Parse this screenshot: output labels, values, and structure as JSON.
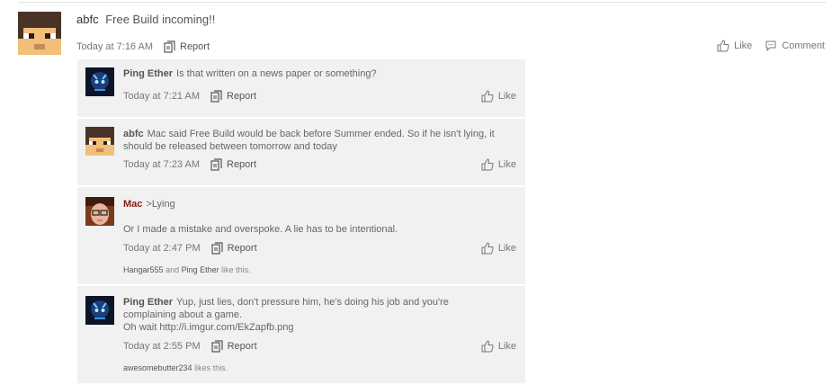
{
  "main_post": {
    "username": "abfc",
    "message": "Free Build incoming!!",
    "time": "Today at 7:16 AM",
    "report_label": "Report",
    "like_label": "Like",
    "comment_label": "Comment"
  },
  "comments": [
    {
      "username": "Ping Ether",
      "lines": [
        "Is that written on a news paper or something?"
      ],
      "time": "Today at 7:21 AM",
      "report_label": "Report",
      "like_label": "Like"
    },
    {
      "username": "abfc",
      "lines": [
        "Mac said Free Build would be back before Summer ended. So if he isn't lying, it",
        "should be released between tomorrow and today"
      ],
      "time": "Today at 7:23 AM",
      "report_label": "Report",
      "like_label": "Like"
    },
    {
      "username": "Mac",
      "lines": [
        ">Lying",
        "Or I made a mistake and overspoke. A lie has to be intentional."
      ],
      "time": "Today at 2:47 PM",
      "report_label": "Report",
      "like_label": "Like",
      "likes": {
        "names": [
          "Hangar555",
          "Ping Ether"
        ],
        "joiner": "and",
        "suffix": "like this."
      }
    },
    {
      "username": "Ping Ether",
      "lines": [
        "Yup, just lies, don't pressure him, he's doing his job and you're",
        "complaining about a game.",
        "Oh wait http://i.imgur.com/EkZapfb.png"
      ],
      "time": "Today at 2:55 PM",
      "report_label": "Report",
      "like_label": "Like",
      "likes": {
        "names": [
          "awesomebutter234"
        ],
        "suffix": "likes this."
      }
    }
  ],
  "colors": {
    "accent_user": "#8b1b12",
    "comment_bg": "#f1f1f1"
  }
}
